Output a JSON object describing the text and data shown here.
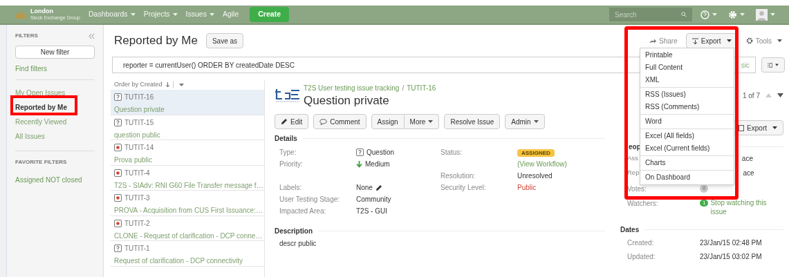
{
  "top_bar": {
    "logo_title": "London",
    "logo_subtitle": "Stock Exchange Group",
    "nav": [
      {
        "label": "Dashboards",
        "dropdown": true
      },
      {
        "label": "Projects",
        "dropdown": true
      },
      {
        "label": "Issues",
        "dropdown": true
      },
      {
        "label": "Agile",
        "dropdown": false
      }
    ],
    "create_button": "Create",
    "search": {
      "placeholder": "Search"
    }
  },
  "sidebar": {
    "heading": "FILTERS",
    "new_filter_button": "New filter",
    "find_filters": "Find filters",
    "items": [
      {
        "label": "My Open Issues",
        "selected": false
      },
      {
        "label": "Reported by Me",
        "selected": true
      },
      {
        "label": "Recently Viewed",
        "selected": false
      },
      {
        "label": "All Issues",
        "selected": false
      }
    ],
    "favorites_heading": "FAVORITE FILTERS",
    "favorites": [
      "Assigned NOT closed"
    ]
  },
  "header": {
    "title": "Reported by Me",
    "save_as": "Save as",
    "share": "Share",
    "export": "Export",
    "tools": "Tools"
  },
  "query": {
    "value": "reporter = currentUser() ORDER BY createdDate DESC",
    "mode_link": "sic"
  },
  "issue_list": {
    "order_label": "Order by Created",
    "issues": [
      {
        "key": "TUTIT-16",
        "summary": "Question private",
        "kind": "question",
        "selected": true
      },
      {
        "key": "TUTIT-15",
        "summary": "question public",
        "kind": "question",
        "selected": false
      },
      {
        "key": "TUTIT-14",
        "summary": "Prova public",
        "kind": "bug",
        "selected": false
      },
      {
        "key": "TUTIT-4",
        "summary": "T2S - SIAdv: RNI G60 File Transfer message f…",
        "kind": "bug",
        "selected": false
      },
      {
        "key": "TUTIT-3",
        "summary": "PROVA - Acquisition from CUS First Issuance:…",
        "kind": "bug",
        "selected": false
      },
      {
        "key": "TUTIT-2",
        "summary": "CLONE - Request of clarification - DCP conne…",
        "kind": "bug",
        "selected": false
      },
      {
        "key": "TUTIT-1",
        "summary": "Request of clarification - DCP connectivity",
        "kind": "question",
        "selected": false
      }
    ]
  },
  "issue": {
    "project": "T2S User testing issue tracking",
    "breadcrumb_separator": "/",
    "key": "TUTIT-16",
    "title": "Question private",
    "actions": [
      {
        "label": "Edit",
        "kind": "edit"
      },
      {
        "label": "Comment",
        "kind": "comment"
      },
      {
        "label": "Assign",
        "kind": "group-start"
      },
      {
        "label": "More",
        "kind": "group-menu"
      },
      {
        "label": "Resolve Issue",
        "kind": "plain"
      },
      {
        "label": "Admin",
        "kind": "menu"
      }
    ],
    "details_heading": "Details",
    "left_fields": [
      {
        "label": "Type:",
        "value": "Question",
        "kind": "type"
      },
      {
        "label": "Priority:",
        "value": "Medium",
        "kind": "priority"
      },
      {
        "kind": "spacer"
      },
      {
        "label": "Labels:",
        "value": "None",
        "kind": "labels"
      },
      {
        "label": "User Testing Stage:",
        "value": "Community",
        "kind": "text"
      },
      {
        "label": "Impacted Area:",
        "value": "T2S - GUI",
        "kind": "text"
      }
    ],
    "right_fields": [
      {
        "label": "Status:",
        "value": "ASSIGNED",
        "kind": "status"
      },
      {
        "value": "(View Workflow)",
        "kind": "link"
      },
      {
        "label": "Resolution:",
        "value": "Unresolved",
        "kind": "text"
      },
      {
        "label": "Security Level:",
        "value": "Public",
        "kind": "alert"
      }
    ],
    "description_heading": "Description",
    "description": "descr public"
  },
  "side_panel": {
    "pager": "1 of 7",
    "export": "Export",
    "people_heading": "eop",
    "people": [
      {
        "label": "Ass",
        "value": "ace"
      },
      {
        "label": "Rep",
        "value": "ace"
      }
    ],
    "votes_label": "Votes:",
    "votes": "0",
    "watchers_label": "Watchers:",
    "watchers": "1",
    "watch_link": "Stop watching this issue",
    "dates_heading": "Dates",
    "dates": [
      {
        "label": "Created:",
        "value": "23/Jan/15 02:48 PM"
      },
      {
        "label": "Updated:",
        "value": "23/Jan/15 03:02 PM"
      }
    ]
  },
  "export_menu": {
    "groups": [
      {
        "items": [
          "Printable",
          "Full Content",
          "XML"
        ]
      },
      {
        "items": [
          "RSS (Issues)",
          "RSS (Comments)"
        ]
      },
      {
        "items": [
          "Word"
        ]
      },
      {
        "items": [
          "Excel (All fields)",
          "Excel (Current fields)"
        ]
      },
      {
        "items": [
          "Charts"
        ]
      },
      {
        "items": [
          "On Dashboard"
        ]
      }
    ]
  }
}
